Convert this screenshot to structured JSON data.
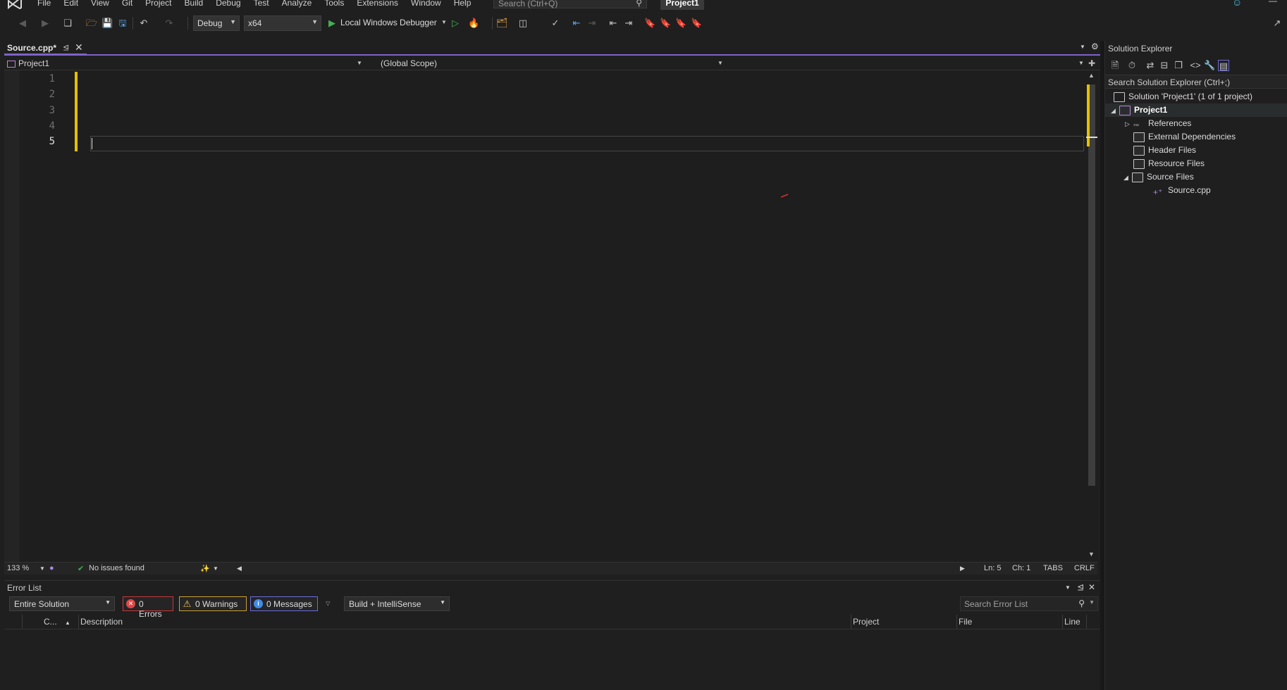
{
  "menu": {
    "items": [
      "File",
      "Edit",
      "View",
      "Git",
      "Project",
      "Build",
      "Debug",
      "Test",
      "Analyze",
      "Tools",
      "Extensions",
      "Window",
      "Help"
    ],
    "search_placeholder": "Search (Ctrl+Q)",
    "project_title": "Project1"
  },
  "toolbar": {
    "config": "Debug",
    "platform": "x64",
    "debugger": "Local Windows Debugger"
  },
  "doc_tab": {
    "title": "Source.cpp*"
  },
  "navbar": {
    "project": "Project1",
    "scope": "(Global Scope)"
  },
  "editor": {
    "line_numbers": [
      "1",
      "2",
      "3",
      "4",
      "5"
    ],
    "current_line": 5
  },
  "editor_status": {
    "zoom": "133 %",
    "issues": "No issues found",
    "ln": "Ln: 5",
    "ch": "Ch: 1",
    "tabs": "TABS",
    "eol": "CRLF"
  },
  "error_list": {
    "title": "Error List",
    "scope": "Entire Solution",
    "errors": "0 Errors",
    "warnings": "0 Warnings",
    "messages": "0 Messages",
    "source": "Build + IntelliSense",
    "search_placeholder": "Search Error List",
    "columns": [
      "C...",
      "Description",
      "Project",
      "File",
      "Line"
    ]
  },
  "solution_explorer": {
    "title": "Solution Explorer",
    "search_placeholder": "Search Solution Explorer (Ctrl+;)",
    "items": [
      {
        "label": "Solution 'Project1'  (1 of 1 project)"
      },
      {
        "label": "Project1"
      },
      {
        "label": "References"
      },
      {
        "label": "External Dependencies"
      },
      {
        "label": "Header Files"
      },
      {
        "label": "Resource Files"
      },
      {
        "label": "Source Files"
      },
      {
        "label": "Source.cpp"
      }
    ]
  },
  "colors": {
    "accent": "#7f62c9",
    "change_bar": "#e5c000",
    "background": "#1f1f1f"
  }
}
